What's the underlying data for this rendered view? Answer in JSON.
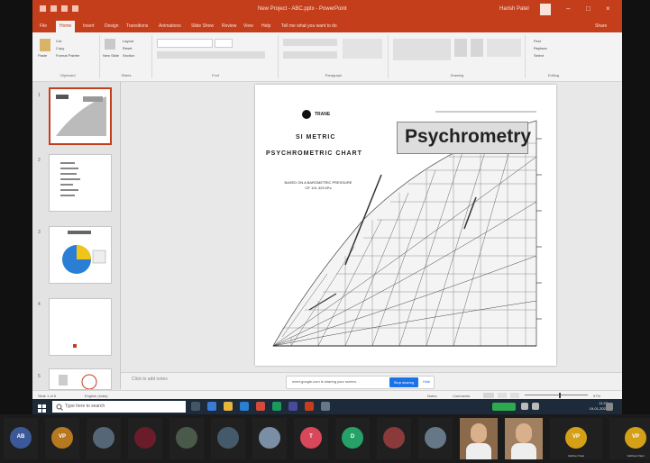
{
  "app": {
    "title": "New Project - ABC.pptx - PowerPoint",
    "user": "Harish Patel"
  },
  "menu": {
    "tabs": [
      "File",
      "Home",
      "Insert",
      "Design",
      "Transitions",
      "Animations",
      "Slide Show",
      "Review",
      "View",
      "Help",
      "Tell me what you want to do"
    ],
    "share": "Share"
  },
  "ribbon": {
    "groups": [
      "Clipboard",
      "Slides",
      "Font",
      "Paragraph",
      "Drawing",
      "Editing"
    ],
    "clipboard_items": [
      "Cut",
      "Copy",
      "Format Painter"
    ],
    "paste": "Paste",
    "new_slide": "New Slide",
    "slides_items": [
      "Layout",
      "Reset",
      "Section"
    ],
    "editing_items": [
      "Find",
      "Replace",
      "Select"
    ]
  },
  "thumbnails": [
    {
      "num": "1",
      "selected": true
    },
    {
      "num": "2",
      "selected": false
    },
    {
      "num": "3",
      "selected": false
    },
    {
      "num": "4",
      "selected": false
    },
    {
      "num": "5",
      "selected": false
    }
  ],
  "slide": {
    "logo_text": "TRANE",
    "si_metric": "SI METRIC",
    "chart_heading": "PSYCHROMETRIC CHART",
    "basis_note": "BASED ON A BAROMETRIC PRESSURE OF 101.325 kPa",
    "title_box": "Psychrometry"
  },
  "notes": {
    "placeholder": "Click to add notes"
  },
  "share_banner": {
    "text": "meet.google.com is sharing your screen.",
    "stop": "Stop sharing",
    "hide": "Hide"
  },
  "statusbar": {
    "slide_info": "Slide 1 of 5",
    "lang": "English (India)",
    "notes_btn": "Notes",
    "comments_btn": "Comments",
    "zoom": "57%"
  },
  "taskbar": {
    "search_placeholder": "Type here to search",
    "time": "11:23",
    "date": "19-01-2022"
  },
  "participants": [
    {
      "kind": "avatar",
      "initials": "AB",
      "color": "#3b5998",
      "name": ""
    },
    {
      "kind": "avatar",
      "initials": "VP",
      "color": "#b7791f",
      "name": ""
    },
    {
      "kind": "avatar",
      "initials": "",
      "color": "#556677",
      "name": ""
    },
    {
      "kind": "avatar",
      "initials": "",
      "color": "#6a1c2a",
      "name": ""
    },
    {
      "kind": "avatar",
      "initials": "",
      "color": "#4a5a4a",
      "name": ""
    },
    {
      "kind": "avatar",
      "initials": "",
      "color": "#445a6a",
      "name": ""
    },
    {
      "kind": "avatar",
      "initials": "",
      "color": "#7a8fa6",
      "name": ""
    },
    {
      "kind": "avatar",
      "initials": "T",
      "color": "#d8485a",
      "name": ""
    },
    {
      "kind": "avatar",
      "initials": "D",
      "color": "#26a269",
      "name": ""
    },
    {
      "kind": "avatar",
      "initials": "",
      "color": "#8a3a3a",
      "name": ""
    },
    {
      "kind": "avatar",
      "initials": "",
      "color": "#667788",
      "name": ""
    },
    {
      "kind": "video",
      "initials": "",
      "color": "#8a6a4a",
      "name": ""
    },
    {
      "kind": "video",
      "initials": "",
      "color": "#a08060",
      "name": ""
    },
    {
      "kind": "avatar",
      "initials": "VP",
      "color": "#d4a017",
      "name": "Vaibhav Patel"
    },
    {
      "kind": "avatar",
      "initials": "VP",
      "color": "#d4a017",
      "name": "Vaibhavi Patel"
    }
  ]
}
